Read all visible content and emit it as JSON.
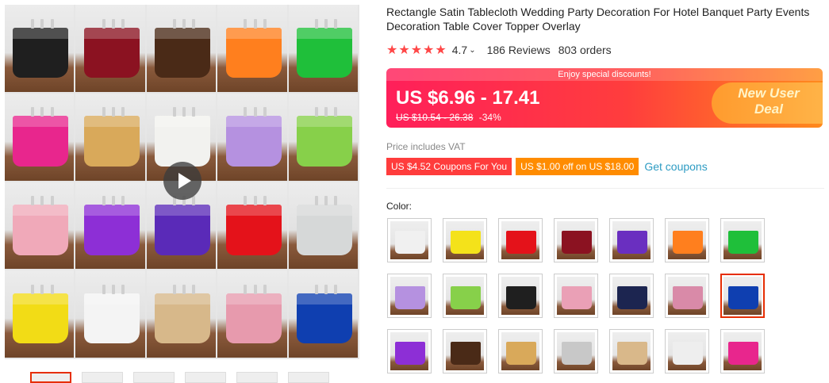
{
  "product": {
    "title": "Rectangle Satin Tablecloth Wedding Party Decoration For Hotel Banquet Party Events Decoration Table Cover Topper Overlay"
  },
  "gallery": {
    "play_icon": "play-icon",
    "tile_colors": [
      "#1f1f1f",
      "#8b1221",
      "#4a2a17",
      "#ff7f1e",
      "#1fbf3a",
      "#e8268d",
      "#d9a95a",
      "#f2f2ef",
      "#b591e0",
      "#87d04a",
      "#f0a9b9",
      "#8d2fd6",
      "#5a2ab8",
      "#e4121a",
      "#d6d8d8",
      "#f2dc16",
      "#f4f4f4",
      "#d7b88a",
      "#e79aad",
      "#0f3fb0"
    ],
    "thumbnail_count": 6
  },
  "rating": {
    "stars": "★★★★★",
    "value": "4.7",
    "reviews": "186 Reviews",
    "orders": "803 orders"
  },
  "price": {
    "banner_note": "Enjoy special discounts!",
    "current": "US $6.96 - 17.41",
    "original": "US $10.54 - 26.38",
    "discount": "-34%",
    "deal_line1": "New User",
    "deal_line2": "Deal"
  },
  "vat_note": "Price includes VAT",
  "coupons": {
    "coupon1": "US $4.52 Coupons For You",
    "coupon2": "US $1.00 off on US $18.00",
    "get": "Get coupons"
  },
  "colors": {
    "label": "Color:",
    "selected_index": 13,
    "swatches": [
      "#f0f0f0",
      "#f4e21a",
      "#e4121a",
      "#8b1221",
      "#6a2fc0",
      "#ff7f1e",
      "#1fbf3a",
      "#b591e0",
      "#87d04a",
      "#1f1f1f",
      "#eaa0b6",
      "#1c2550",
      "#d98aa8",
      "#0f3fb0",
      "#8d2fd6",
      "#4a2a17",
      "#d9a95a",
      "#c8c8c8",
      "#d9b88a",
      "#eeeeee",
      "#e8268d"
    ]
  }
}
